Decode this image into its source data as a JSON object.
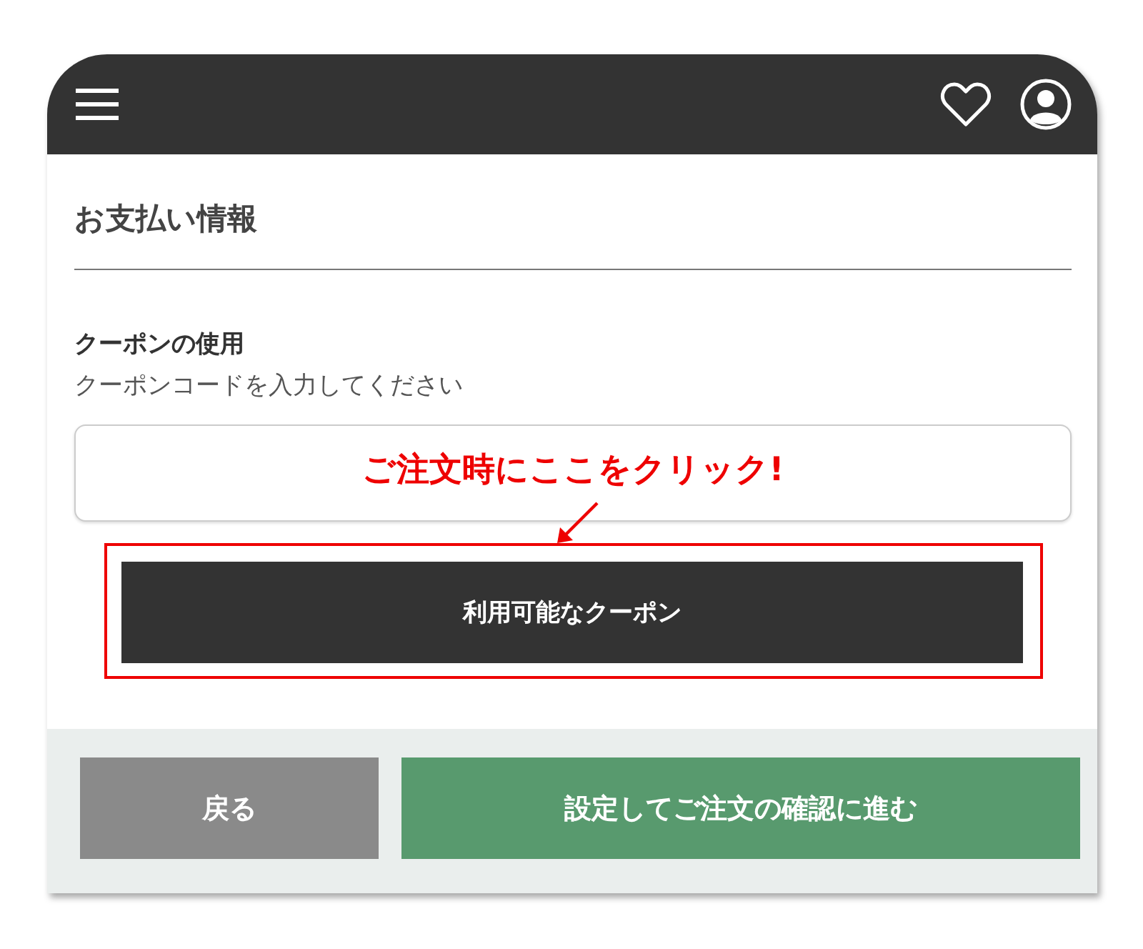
{
  "header": {
    "icons": [
      {
        "kind": "menu"
      },
      {
        "kind": "heart"
      },
      {
        "kind": "account"
      }
    ]
  },
  "page_title": "お支払い情報",
  "coupon": {
    "label": "クーポンの使用",
    "instruction": "クーポンコードを入力してください",
    "button": "利用可能なクーポン"
  },
  "annotation": {
    "text": "ご注文時にここをクリック!"
  },
  "footer": {
    "buttons": [
      {
        "label": "戻る",
        "kind": "secondary"
      },
      {
        "label": "設定してご注文の確認に進む",
        "kind": "primary"
      }
    ]
  }
}
